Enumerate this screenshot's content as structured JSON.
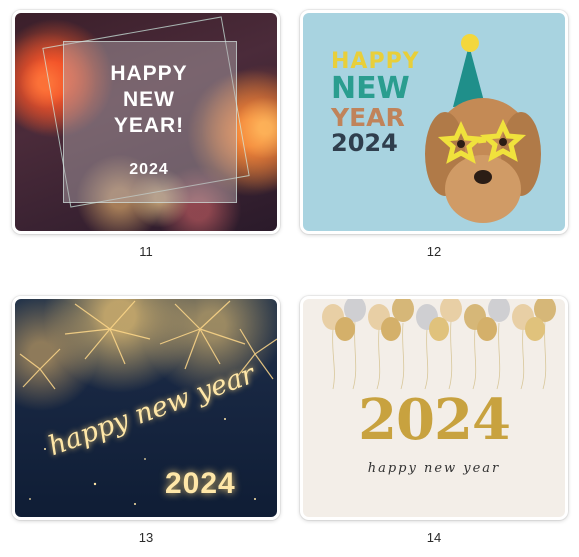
{
  "cards": [
    {
      "number": "11",
      "headline_lines": [
        "HAPPY",
        "NEW",
        "YEAR!"
      ],
      "year": "2024",
      "colors": {
        "bg": "#3b1f2a",
        "text": "#ffffff"
      }
    },
    {
      "number": "12",
      "headline_lines": [
        "HAPPY",
        "NEW",
        "YEAR",
        "2024"
      ],
      "colors": {
        "bg": "#a8d3e0",
        "happy": "#e8cf3a",
        "new": "#2a9d8f",
        "year": "#c0835a",
        "year_num": "#2f3e4d"
      },
      "icons": [
        "dog-icon",
        "party-hat-icon",
        "star-glasses-icon"
      ]
    },
    {
      "number": "13",
      "script_text": "happy new year",
      "year": "2024",
      "colors": {
        "bg": "#182742",
        "text": "#ffe7a8"
      }
    },
    {
      "number": "14",
      "year": "2024",
      "script_text": "happy new year",
      "colors": {
        "bg": "#f3eee8",
        "year": "#c8a23f"
      },
      "icons": [
        "balloons-icon"
      ]
    }
  ]
}
